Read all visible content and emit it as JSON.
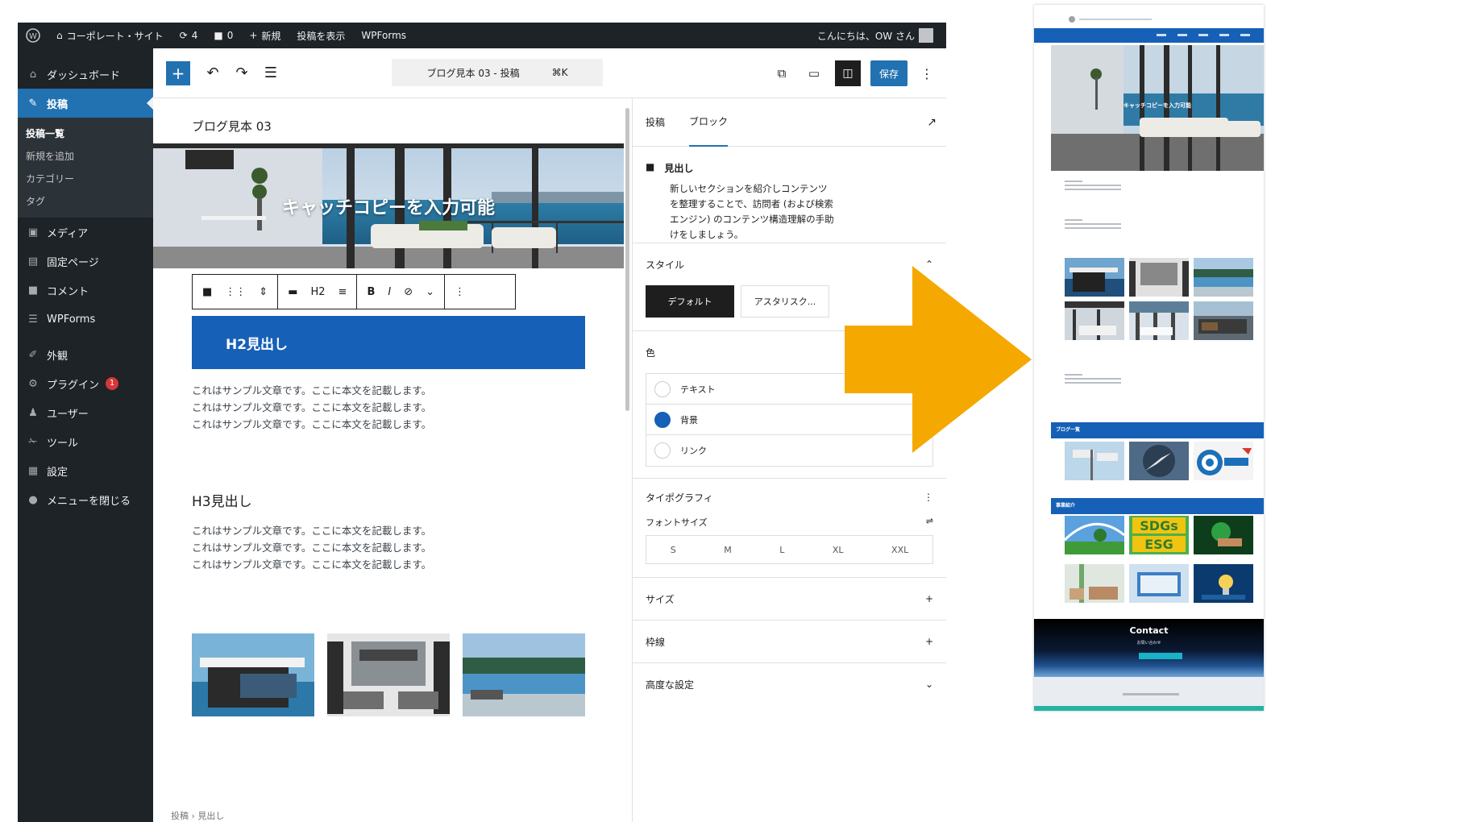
{
  "admin_bar": {
    "site_name": "コーポレート・サイト",
    "updates_count": "4",
    "comments_count": "0",
    "new_label": "新規",
    "view_post_label": "投稿を表示",
    "wpforms_label": "WPForms",
    "greeting": "こんにちは、OW さん"
  },
  "sidebar": {
    "items": [
      {
        "icon": "dashboard-icon",
        "glyph": "⌂",
        "label": "ダッシュボード"
      },
      {
        "icon": "pin-icon",
        "glyph": "✎",
        "label": "投稿"
      },
      {
        "icon": "media-icon",
        "glyph": "▣",
        "label": "メディア"
      },
      {
        "icon": "page-icon",
        "glyph": "▤",
        "label": "固定ページ"
      },
      {
        "icon": "comment-icon",
        "glyph": "■",
        "label": "コメント"
      },
      {
        "icon": "form-icon",
        "glyph": "☰",
        "label": "WPForms"
      },
      {
        "icon": "appearance-icon",
        "glyph": "✐",
        "label": "外観"
      },
      {
        "icon": "plugin-icon",
        "glyph": "⚙",
        "label": "プラグイン",
        "badge": "1"
      },
      {
        "icon": "users-icon",
        "glyph": "♟",
        "label": "ユーザー"
      },
      {
        "icon": "tools-icon",
        "glyph": "✁",
        "label": "ツール"
      },
      {
        "icon": "settings-icon",
        "glyph": "▦",
        "label": "設定"
      },
      {
        "icon": "collapse-icon",
        "glyph": "●",
        "label": "メニューを閉じる"
      }
    ],
    "submenu": [
      "投稿一覧",
      "新規を追加",
      "カテゴリー",
      "タグ"
    ]
  },
  "topbar": {
    "doc_title": "ブログ見本 03 - 投稿",
    "shortcut": "⌘K",
    "save_label": "保存"
  },
  "canvas": {
    "post_title": "ブログ見本 03",
    "hero_text": "キャッチコピーを入力可能",
    "h2_text": "H2見出し",
    "h3_text": "H3見出し",
    "paragraph_lines": [
      "これはサンプル文章です。ここに本文を記載します。",
      "これはサンプル文章です。ここに本文を記載します。",
      "これはサンプル文章です。ここに本文を記載します。"
    ],
    "breadcrumb": "投稿 › 見出し"
  },
  "inspector": {
    "tabs": [
      "投稿",
      "ブロック"
    ],
    "block_name": "見出し",
    "block_description": "新しいセクションを紹介しコンテンツを整理することで、訪問者 (および検索エンジン) のコンテンツ構造理解の手助けをしましょう。",
    "styles_title": "スタイル",
    "style_options": [
      "デフォルト",
      "アスタリスク..."
    ],
    "color_title": "色",
    "color_options": [
      {
        "label": "テキスト",
        "swatch": "#ffffff"
      },
      {
        "label": "背景",
        "swatch": "#1660b7"
      },
      {
        "label": "リンク",
        "swatch": "#ffffff"
      }
    ],
    "typography_title": "タイポグラフィ",
    "font_size_label": "フォントサイズ",
    "font_sizes": [
      "S",
      "M",
      "L",
      "XL",
      "XXL"
    ],
    "dimensions_title": "サイズ",
    "border_title": "枠線",
    "advanced_title": "高度な設定"
  },
  "preview": {
    "hero_text": "キャッチコピーを入力可能",
    "news_title": "ブログ一覧",
    "service_title": "事業紹介",
    "contact_title": "Contact",
    "contact_sub": "お問い合わせ"
  },
  "colors": {
    "admin_dark": "#1d2327",
    "wp_blue": "#2271b1",
    "heading_blue": "#1660b7",
    "arrow_orange": "#f5a800"
  }
}
